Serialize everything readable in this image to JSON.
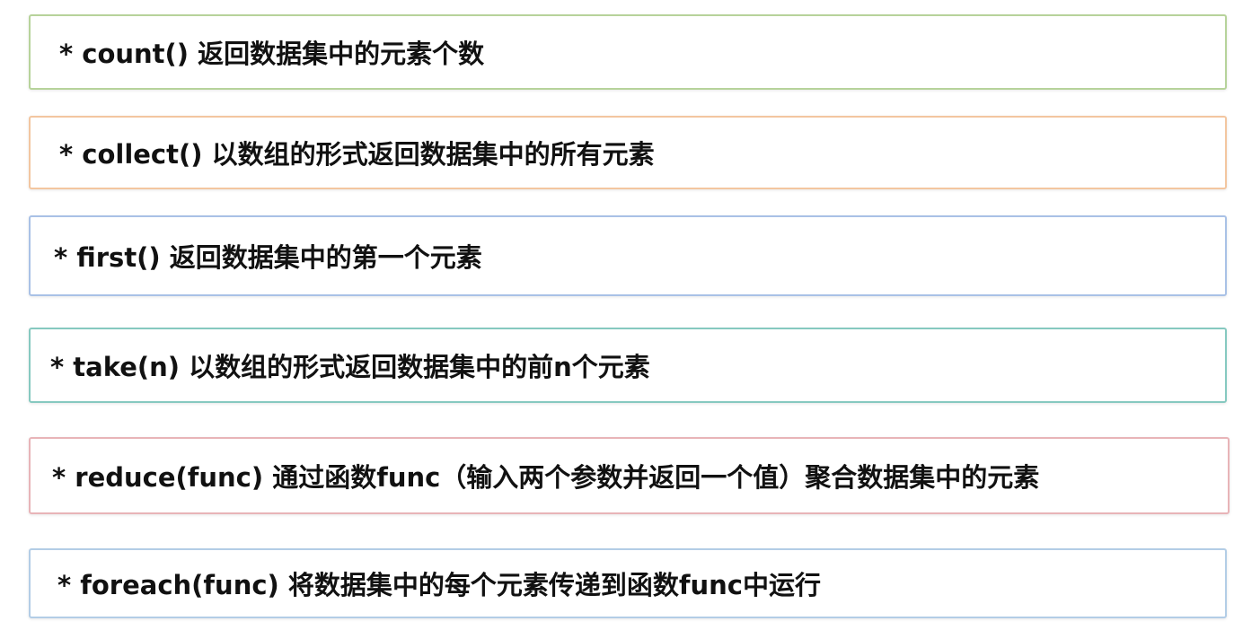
{
  "items": [
    {
      "text": "* count() 返回数据集中的元素个数",
      "border_color": "#b7d39b"
    },
    {
      "text": "* collect() 以数组的形式返回数据集中的所有元素",
      "border_color": "#f3c6a0"
    },
    {
      "text": "* first() 返回数据集中的第一个元素",
      "border_color": "#a9c1e6"
    },
    {
      "text": "* take(n) 以数组的形式返回数据集中的前n个元素",
      "border_color": "#86c9c0"
    },
    {
      "text": "* reduce(func) 通过函数func（输入两个参数并返回一个值）聚合数据集中的元素",
      "border_color": "#e8b4b8"
    },
    {
      "text": "* foreach(func) 将数据集中的每个元素传递到函数func中运行",
      "border_color": "#b3cde6"
    }
  ]
}
